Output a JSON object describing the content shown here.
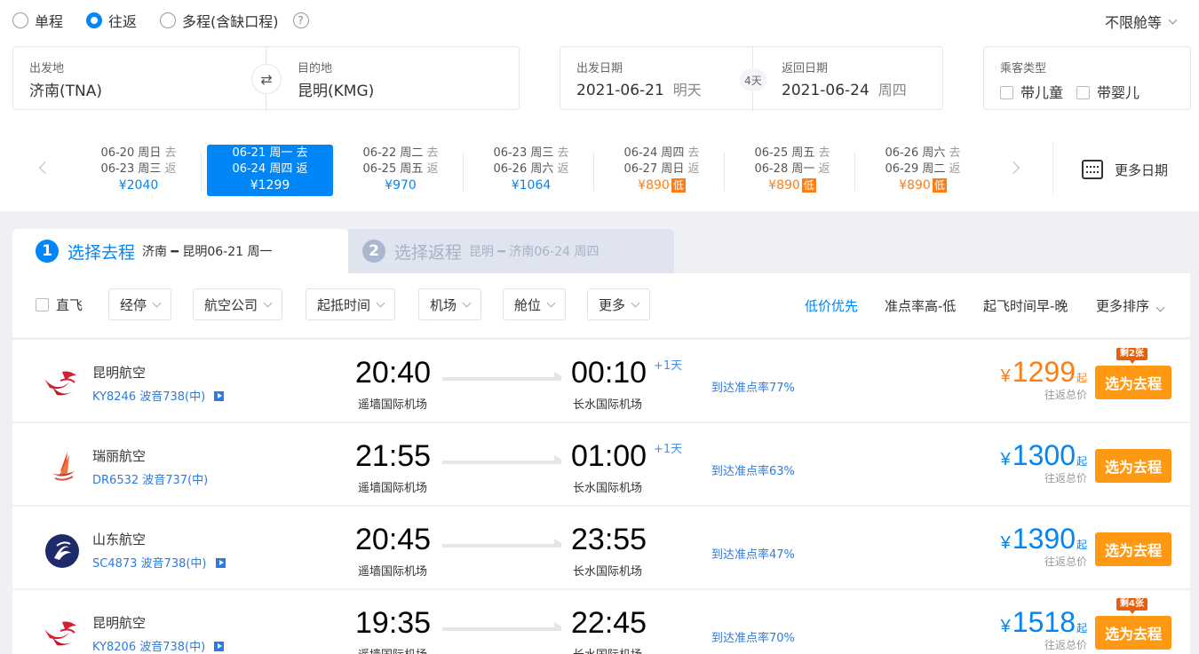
{
  "trip_type": {
    "options": [
      "单程",
      "往返",
      "多程(含缺口程)"
    ],
    "selected": "往返",
    "help_icon": "?"
  },
  "cabin": {
    "label": "不限舱等"
  },
  "route": {
    "from_label": "出发地",
    "from_value": "济南(TNA)",
    "to_label": "目的地",
    "to_value": "昆明(KMG)",
    "swap_icon": "swap-icon"
  },
  "dates": {
    "depart_label": "出发日期",
    "depart_value": "2021-06-21",
    "depart_sub": "明天",
    "days_badge": "4天",
    "return_label": "返回日期",
    "return_value": "2021-06-24",
    "return_sub": "周四"
  },
  "passengers": {
    "label": "乘客类型",
    "child": "带儿童",
    "infant": "带婴儿"
  },
  "date_strip": {
    "cells": [
      {
        "go": "06-20  周日",
        "go_tag": "去",
        "back": "06-23  周三",
        "back_tag": "返",
        "price": "¥2040",
        "low": false,
        "active": false
      },
      {
        "go": "06-21  周一",
        "go_tag": "去",
        "back": "06-24  周四",
        "back_tag": "返",
        "price": "¥1299",
        "low": false,
        "active": true
      },
      {
        "go": "06-22  周二",
        "go_tag": "去",
        "back": "06-25  周五",
        "back_tag": "返",
        "price": "¥970",
        "low": false,
        "active": false
      },
      {
        "go": "06-23  周三",
        "go_tag": "去",
        "back": "06-26  周六",
        "back_tag": "返",
        "price": "¥1064",
        "low": false,
        "active": false
      },
      {
        "go": "06-24  周四",
        "go_tag": "去",
        "back": "06-27  周日",
        "back_tag": "返",
        "price": "¥890",
        "low": true,
        "active": false
      },
      {
        "go": "06-25  周五",
        "go_tag": "去",
        "back": "06-28  周一",
        "back_tag": "返",
        "price": "¥890",
        "low": true,
        "active": false
      },
      {
        "go": "06-26  周六",
        "go_tag": "去",
        "back": "06-29  周二",
        "back_tag": "返",
        "price": "¥890",
        "low": true,
        "active": false
      }
    ],
    "low_tag": "低",
    "more_dates": "更多日期"
  },
  "steps": {
    "step1_num": "1",
    "step1_title": "选择去程",
    "step1_route": "济南 ━ 昆明06-21 周一",
    "step2_num": "2",
    "step2_title": "选择返程",
    "step2_route": "昆明 ━ 济南06-24 周四"
  },
  "filters": {
    "direct": "直飞",
    "chips": [
      "经停",
      "航空公司",
      "起抵时间",
      "机场",
      "舱位",
      "更多"
    ]
  },
  "sort": {
    "options": [
      "低价优先",
      "准点率高-低",
      "起飞时间早-晚",
      "更多排序"
    ],
    "active": "低价优先"
  },
  "flights": [
    {
      "airline": "昆明航空",
      "flight_no": "KY8246 波音738(中)",
      "has_video": true,
      "dep_time": "20:40",
      "dep_airport": "遥墙国际机场",
      "arr_time": "00:10",
      "arr_airport": "长水国际机场",
      "plus_day": "+1天",
      "ontime": "到达准点率77%",
      "price": "1299",
      "price_color": "orange",
      "price_note": "往返总价",
      "remain": "剩2张",
      "btn": "选为去程"
    },
    {
      "airline": "瑞丽航空",
      "flight_no": "DR6532 波音737(中)",
      "has_video": false,
      "dep_time": "21:55",
      "dep_airport": "遥墙国际机场",
      "arr_time": "01:00",
      "arr_airport": "长水国际机场",
      "plus_day": "+1天",
      "ontime": "到达准点率63%",
      "price": "1300",
      "price_color": "blue",
      "price_note": "往返总价",
      "remain": "",
      "btn": "选为去程"
    },
    {
      "airline": "山东航空",
      "flight_no": "SC4873 波音738(中)",
      "has_video": true,
      "dep_time": "20:45",
      "dep_airport": "遥墙国际机场",
      "arr_time": "23:55",
      "arr_airport": "长水国际机场",
      "plus_day": "",
      "ontime": "到达准点率47%",
      "price": "1390",
      "price_color": "blue",
      "price_note": "往返总价",
      "remain": "",
      "btn": "选为去程"
    },
    {
      "airline": "昆明航空",
      "flight_no": "KY8206 波音738(中)",
      "has_video": true,
      "dep_time": "19:35",
      "dep_airport": "遥墙国际机场",
      "arr_time": "22:45",
      "arr_airport": "长水国际机场",
      "plus_day": "",
      "ontime": "到达准点率70%",
      "price": "1518",
      "price_color": "blue",
      "price_note": "往返总价",
      "remain": "剩4张",
      "btn": "选为去程"
    }
  ],
  "currency": "¥",
  "price_suffix": "起",
  "colors": {
    "accent": "#0086f6",
    "orange": "#ff7d13",
    "button": "#ff9913"
  }
}
